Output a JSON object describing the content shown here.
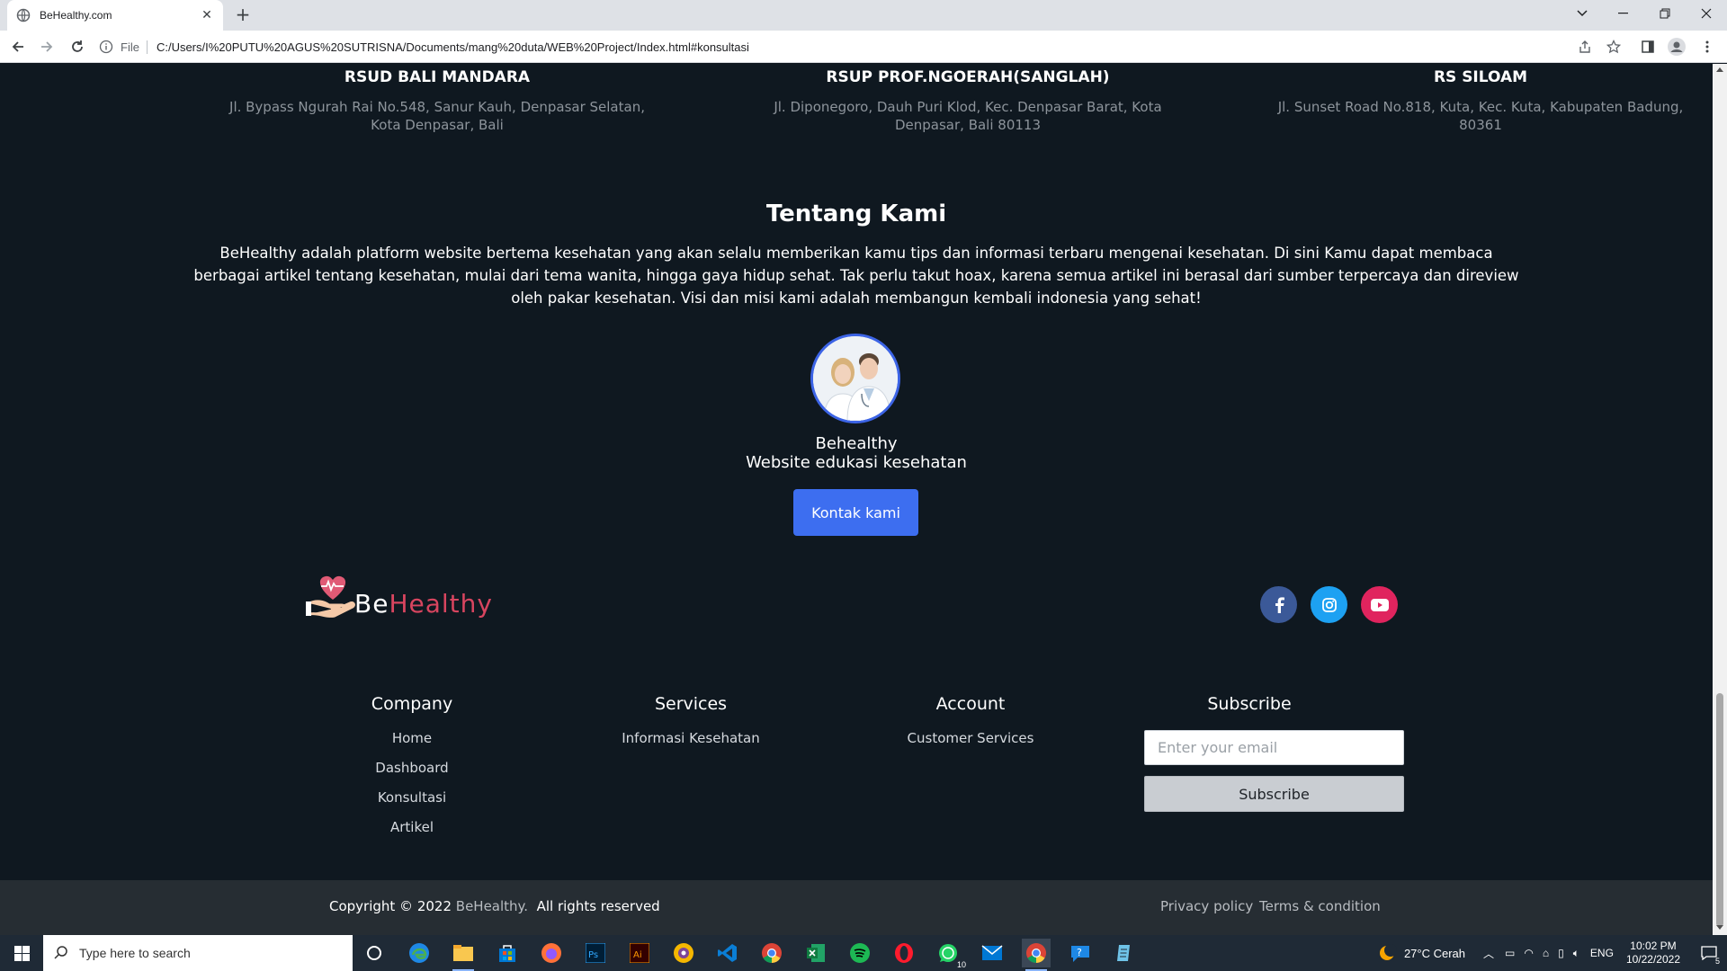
{
  "browser": {
    "tab_title": "BeHealthy.com",
    "url_scheme": "File",
    "url": "C:/Users/I%20PUTU%20AGUS%20SUTRISNA/Documents/mang%20duta/WEB%20Project/Index.html#konsultasi"
  },
  "hospitals": [
    {
      "name": "RSUD BALI MANDARA",
      "address": "Jl. Bypass Ngurah Rai No.548, Sanur Kauh, Denpasar Selatan, Kota Denpasar, Bali"
    },
    {
      "name": "RSUP PROF.NGOERAH(SANGLAH)",
      "address": "Jl. Diponegoro, Dauh Puri Klod, Kec. Denpasar Barat, Kota Denpasar, Bali 80113"
    },
    {
      "name": "RS SILOAM",
      "address": "Jl. Sunset Road No.818, Kuta, Kec. Kuta, Kabupaten Badung, 80361"
    }
  ],
  "about": {
    "title": "Tentang Kami",
    "text": "BeHealthy adalah platform website bertema kesehatan yang akan selalu memberikan kamu tips dan informasi terbaru mengenai kesehatan. Di sini Kamu dapat membaca berbagai artikel tentang kesehatan, mulai dari tema wanita, hingga gaya hidup sehat. Tak perlu takut hoax, karena semua artikel ini berasal dari sumber terpercaya dan direview oleh pakar kesehatan. Visi dan misi kami adalah membangun kembali indonesia yang sehat!",
    "name": "Behealthy",
    "subtitle": "Website edukasi kesehatan",
    "contact_button": "Kontak kami"
  },
  "logo": {
    "part1": "Be",
    "part2": "Healthy",
    "icon": "heart-hand-icon"
  },
  "social": [
    {
      "name": "facebook-icon",
      "color": "#3b5998"
    },
    {
      "name": "instagram-icon",
      "color": "#1da1f2"
    },
    {
      "name": "youtube-icon",
      "color": "#e0245e"
    }
  ],
  "footer": {
    "company": {
      "title": "Company",
      "links": [
        "Home",
        "Dashboard",
        "Konsultasi",
        "Artikel"
      ]
    },
    "services": {
      "title": "Services",
      "links": [
        "Informasi Kesehatan"
      ]
    },
    "account": {
      "title": "Account",
      "links": [
        "Customer Services"
      ]
    },
    "subscribe": {
      "title": "Subscribe",
      "placeholder": "Enter your email",
      "button": "Subscribe"
    }
  },
  "bottom": {
    "copyright_prefix": "Copyright © 2022 ",
    "copyright_brand": "BeHealthy.",
    "copyright_suffix": "All rights reserved",
    "privacy": "Privacy policy",
    "terms": "Terms & condition"
  },
  "taskbar": {
    "search_placeholder": "Type here to search",
    "weather": "27°C  Cerah",
    "language": "ENG",
    "time": "10:02 PM",
    "date": "10/22/2022",
    "whatsapp_badge": "10",
    "notification_count": "5"
  },
  "colors": {
    "accent": "#3d6ef0",
    "brand_red": "#d8455f",
    "background": "#0f1820"
  }
}
